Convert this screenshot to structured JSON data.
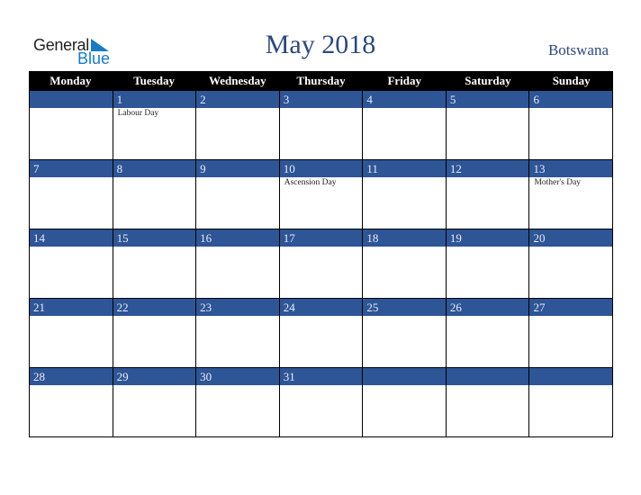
{
  "logo": {
    "word1": "General",
    "word2": "Blue"
  },
  "header": {
    "title": "May 2018",
    "country": "Botswana"
  },
  "weekdays": [
    "Monday",
    "Tuesday",
    "Wednesday",
    "Thursday",
    "Friday",
    "Saturday",
    "Sunday"
  ],
  "weeks": [
    [
      {
        "d": ""
      },
      {
        "d": "1",
        "e": "Labour Day"
      },
      {
        "d": "2"
      },
      {
        "d": "3"
      },
      {
        "d": "4"
      },
      {
        "d": "5"
      },
      {
        "d": "6"
      }
    ],
    [
      {
        "d": "7"
      },
      {
        "d": "8"
      },
      {
        "d": "9"
      },
      {
        "d": "10",
        "e": "Ascension Day"
      },
      {
        "d": "11"
      },
      {
        "d": "12"
      },
      {
        "d": "13",
        "e": "Mother's Day"
      }
    ],
    [
      {
        "d": "14"
      },
      {
        "d": "15"
      },
      {
        "d": "16"
      },
      {
        "d": "17"
      },
      {
        "d": "18"
      },
      {
        "d": "19"
      },
      {
        "d": "20"
      }
    ],
    [
      {
        "d": "21"
      },
      {
        "d": "22"
      },
      {
        "d": "23"
      },
      {
        "d": "24"
      },
      {
        "d": "25"
      },
      {
        "d": "26"
      },
      {
        "d": "27"
      }
    ],
    [
      {
        "d": "28"
      },
      {
        "d": "29"
      },
      {
        "d": "30"
      },
      {
        "d": "31"
      },
      {
        "d": ""
      },
      {
        "d": ""
      },
      {
        "d": ""
      }
    ]
  ]
}
